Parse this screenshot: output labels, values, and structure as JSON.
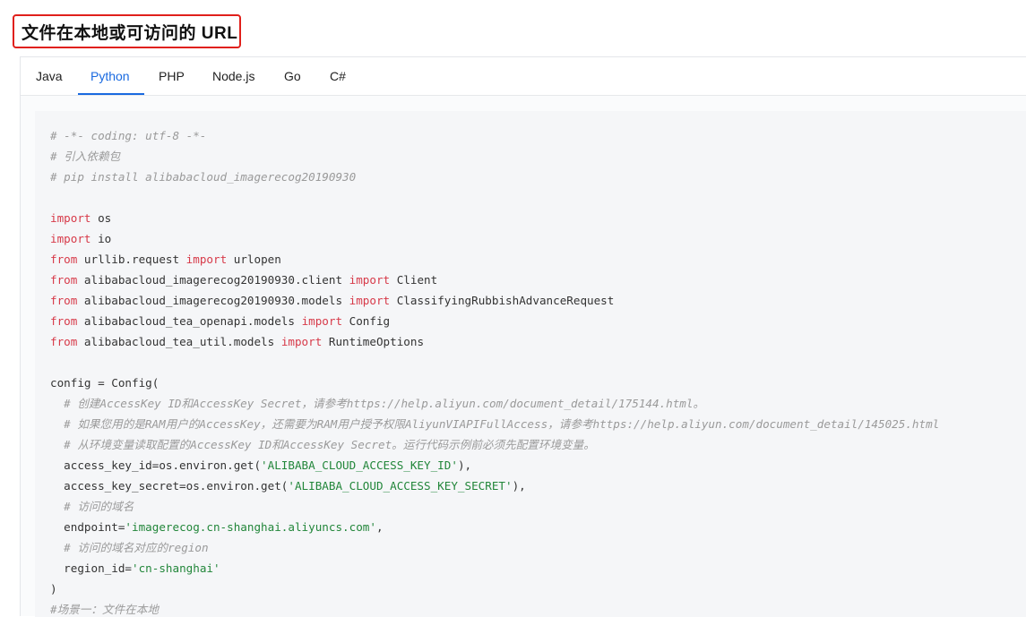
{
  "heading": "文件在本地或可访问的 URL",
  "tabs": [
    {
      "label": "Java",
      "active": false
    },
    {
      "label": "Python",
      "active": true
    },
    {
      "label": "PHP",
      "active": false
    },
    {
      "label": "Node.js",
      "active": false
    },
    {
      "label": "Go",
      "active": false
    },
    {
      "label": "C#",
      "active": false
    }
  ],
  "colors": {
    "accent": "#1a6ae0",
    "highlight_border": "#e0201b",
    "keyword": "#d73a49",
    "string": "#22863a",
    "comment": "#9a9a9a"
  },
  "code_lines": [
    [
      {
        "t": "c",
        "v": "# -*- coding: utf-8 -*-"
      }
    ],
    [
      {
        "t": "c",
        "v": "# 引入依赖包"
      }
    ],
    [
      {
        "t": "c",
        "v": "# pip install alibabacloud_imagerecog20190930"
      }
    ],
    [],
    [
      {
        "t": "k",
        "v": "import"
      },
      {
        "t": "p",
        "v": " os"
      }
    ],
    [
      {
        "t": "k",
        "v": "import"
      },
      {
        "t": "p",
        "v": " io"
      }
    ],
    [
      {
        "t": "k",
        "v": "from"
      },
      {
        "t": "p",
        "v": " urllib.request "
      },
      {
        "t": "k",
        "v": "import"
      },
      {
        "t": "p",
        "v": " urlopen"
      }
    ],
    [
      {
        "t": "k",
        "v": "from"
      },
      {
        "t": "p",
        "v": " alibabacloud_imagerecog20190930.client "
      },
      {
        "t": "k",
        "v": "import"
      },
      {
        "t": "p",
        "v": " Client"
      }
    ],
    [
      {
        "t": "k",
        "v": "from"
      },
      {
        "t": "p",
        "v": " alibabacloud_imagerecog20190930.models "
      },
      {
        "t": "k",
        "v": "import"
      },
      {
        "t": "p",
        "v": " ClassifyingRubbishAdvanceRequest"
      }
    ],
    [
      {
        "t": "k",
        "v": "from"
      },
      {
        "t": "p",
        "v": " alibabacloud_tea_openapi.models "
      },
      {
        "t": "k",
        "v": "import"
      },
      {
        "t": "p",
        "v": " Config"
      }
    ],
    [
      {
        "t": "k",
        "v": "from"
      },
      {
        "t": "p",
        "v": " alibabacloud_tea_util.models "
      },
      {
        "t": "k",
        "v": "import"
      },
      {
        "t": "p",
        "v": " RuntimeOptions"
      }
    ],
    [],
    [
      {
        "t": "p",
        "v": "config = Config("
      }
    ],
    [
      {
        "t": "p",
        "v": "  "
      },
      {
        "t": "c",
        "v": "# 创建AccessKey ID和AccessKey Secret，请参考https://help.aliyun.com/document_detail/175144.html。"
      }
    ],
    [
      {
        "t": "p",
        "v": "  "
      },
      {
        "t": "c",
        "v": "# 如果您用的是RAM用户的AccessKey，还需要为RAM用户授予权限AliyunVIAPIFullAccess，请参考https://help.aliyun.com/document_detail/145025.html"
      }
    ],
    [
      {
        "t": "p",
        "v": "  "
      },
      {
        "t": "c",
        "v": "# 从环境变量读取配置的AccessKey ID和AccessKey Secret。运行代码示例前必须先配置环境变量。"
      }
    ],
    [
      {
        "t": "p",
        "v": "  access_key_id=os.environ.get("
      },
      {
        "t": "s",
        "v": "'ALIBABA_CLOUD_ACCESS_KEY_ID'"
      },
      {
        "t": "p",
        "v": "),"
      }
    ],
    [
      {
        "t": "p",
        "v": "  access_key_secret=os.environ.get("
      },
      {
        "t": "s",
        "v": "'ALIBABA_CLOUD_ACCESS_KEY_SECRET'"
      },
      {
        "t": "p",
        "v": "),"
      }
    ],
    [
      {
        "t": "p",
        "v": "  "
      },
      {
        "t": "c",
        "v": "# 访问的域名"
      }
    ],
    [
      {
        "t": "p",
        "v": "  endpoint="
      },
      {
        "t": "s",
        "v": "'imagerecog.cn-shanghai.aliyuncs.com'"
      },
      {
        "t": "p",
        "v": ","
      }
    ],
    [
      {
        "t": "p",
        "v": "  "
      },
      {
        "t": "c",
        "v": "# 访问的域名对应的region"
      }
    ],
    [
      {
        "t": "p",
        "v": "  region_id="
      },
      {
        "t": "s",
        "v": "'cn-shanghai'"
      }
    ],
    [
      {
        "t": "p",
        "v": ")"
      }
    ],
    [
      {
        "t": "c",
        "v": "#场景一：文件在本地"
      }
    ]
  ]
}
